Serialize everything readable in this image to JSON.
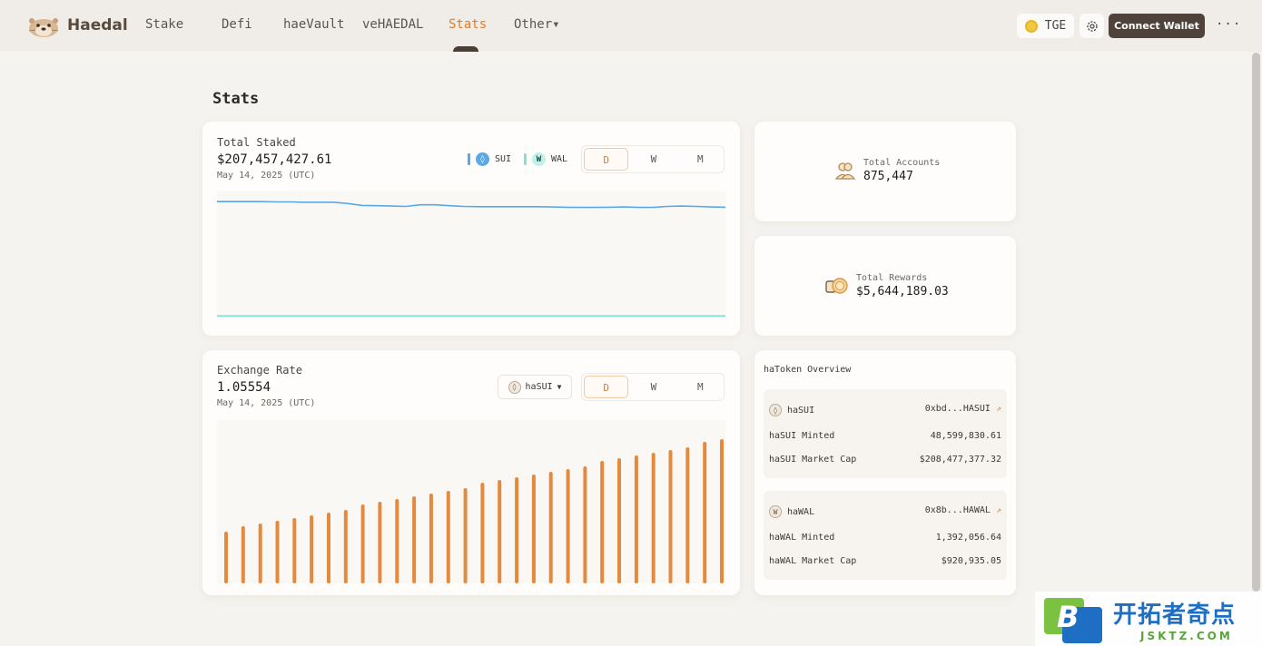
{
  "nav": {
    "brand": "Haedal",
    "items": [
      "Stake",
      "Defi",
      "haeVault",
      "veHAEDAL",
      "Stats",
      "Other▾"
    ],
    "active_index": 4,
    "tge_label": "TGE",
    "connect_label": "Connect Wallet",
    "more_label": "···"
  },
  "page": {
    "title": "Stats"
  },
  "total_staked": {
    "label": "Total Staked",
    "value": "$207,457,427.61",
    "date": "May 14, 2025 (UTC)",
    "legend": [
      {
        "name": "SUI",
        "color": "#5aa9e6"
      },
      {
        "name": "WAL",
        "color": "#7fe3d8"
      }
    ],
    "periods": [
      "D",
      "W",
      "M"
    ],
    "active_period": "D"
  },
  "exchange_rate": {
    "label": "Exchange Rate",
    "value": "1.05554",
    "date": "May 14, 2025 (UTC)",
    "selected_token": "haSUI",
    "periods": [
      "D",
      "W",
      "M"
    ],
    "active_period": "D"
  },
  "accounts": {
    "label": "Total Accounts",
    "value": "875,447"
  },
  "rewards": {
    "label": "Total Rewards",
    "value": "$5,644,189.03"
  },
  "overview": {
    "title": "haToken Overview",
    "tokens": [
      {
        "name": "haSUI",
        "address": "0xbd...HASUI",
        "minted_label": "haSUI Minted",
        "minted_value": "48,599,830.61",
        "cap_label": "haSUI Market Cap",
        "cap_value": "$208,477,377.32"
      },
      {
        "name": "haWAL",
        "address": "0x8b...HAWAL",
        "minted_label": "haWAL Minted",
        "minted_value": "1,392,056.64",
        "cap_label": "haWAL Market Cap",
        "cap_value": "$920,935.05"
      }
    ]
  },
  "watermark": {
    "cn": "开拓者奇点",
    "en": "JSKTZ.COM"
  },
  "chart_data": [
    {
      "type": "line",
      "series": [
        {
          "name": "SUI",
          "color": "#5aa9e6",
          "values": [
            0.92,
            0.92,
            0.92,
            0.92,
            0.918,
            0.918,
            0.915,
            0.915,
            0.915,
            0.905,
            0.89,
            0.888,
            0.885,
            0.882,
            0.895,
            0.895,
            0.888,
            0.882,
            0.88,
            0.88,
            0.88,
            0.88,
            0.88,
            0.878,
            0.876,
            0.874,
            0.874,
            0.876,
            0.878,
            0.874,
            0.874,
            0.882,
            0.885,
            0.882,
            0.878,
            0.876
          ]
        },
        {
          "name": "WAL",
          "color": "#7fe3d8",
          "values": [
            0.02,
            0.02,
            0.02,
            0.02,
            0.02,
            0.02,
            0.02,
            0.02,
            0.02,
            0.02,
            0.02,
            0.02,
            0.02,
            0.02,
            0.02,
            0.02,
            0.02,
            0.02,
            0.02,
            0.02,
            0.02,
            0.02,
            0.02,
            0.02,
            0.02,
            0.02,
            0.02,
            0.02,
            0.02,
            0.02,
            0.02,
            0.02,
            0.02,
            0.02,
            0.02,
            0.02
          ]
        }
      ]
    },
    {
      "type": "bar",
      "color": "#e38a3f",
      "values": [
        1.0473,
        1.0477,
        1.0479,
        1.0481,
        1.0483,
        1.0485,
        1.0487,
        1.0489,
        1.0493,
        1.0495,
        1.0497,
        1.0499,
        1.0501,
        1.0503,
        1.0505,
        1.0509,
        1.0511,
        1.0513,
        1.0515,
        1.0517,
        1.0519,
        1.0521,
        1.0525,
        1.0527,
        1.0529,
        1.0531,
        1.0533,
        1.0535,
        1.0539,
        1.0541
      ],
      "ylim": [
        1.0435,
        1.0555
      ]
    }
  ]
}
